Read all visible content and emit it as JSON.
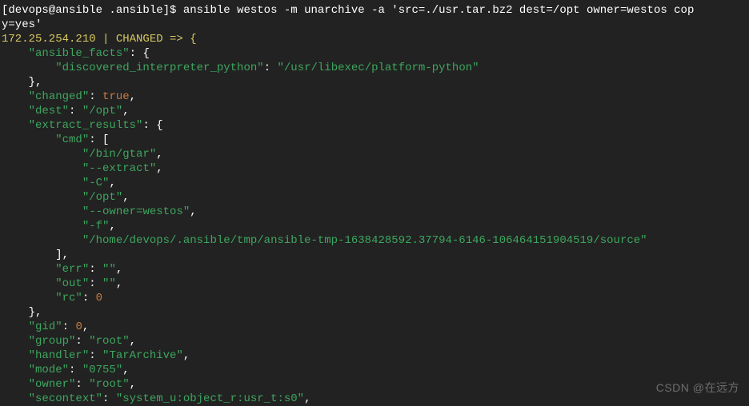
{
  "prompt": {
    "user_host_path": "[devops@ansible .ansible]",
    "symbol": "$",
    "command": "ansible westos -m unarchive -a 'src=./usr.tar.bz2 dest=/opt owner=westos copy=yes'"
  },
  "status_line": "172.25.254.210 | CHANGED => {",
  "output": {
    "lines": [
      {
        "indent": 1,
        "key": "\"ansible_facts\"",
        "sep": ": {",
        "val": ""
      },
      {
        "indent": 2,
        "key": "\"discovered_interpreter_python\"",
        "sep": ": ",
        "val": "\"/usr/libexec/platform-python\""
      },
      {
        "indent": 1,
        "key": "},",
        "sep": "",
        "val": ""
      },
      {
        "indent": 1,
        "key": "\"changed\"",
        "sep": ": ",
        "val": "true",
        "vnum": true,
        "comma": ","
      },
      {
        "indent": 1,
        "key": "\"dest\"",
        "sep": ": ",
        "val": "\"/opt\"",
        "comma": ","
      },
      {
        "indent": 1,
        "key": "\"extract_results\"",
        "sep": ": {",
        "val": ""
      },
      {
        "indent": 2,
        "key": "\"cmd\"",
        "sep": ": [",
        "val": ""
      },
      {
        "indent": 3,
        "key": "",
        "sep": "",
        "val": "\"/bin/gtar\"",
        "comma": ","
      },
      {
        "indent": 3,
        "key": "",
        "sep": "",
        "val": "\"--extract\"",
        "comma": ","
      },
      {
        "indent": 3,
        "key": "",
        "sep": "",
        "val": "\"-C\"",
        "comma": ","
      },
      {
        "indent": 3,
        "key": "",
        "sep": "",
        "val": "\"/opt\"",
        "comma": ","
      },
      {
        "indent": 3,
        "key": "",
        "sep": "",
        "val": "\"--owner=westos\"",
        "comma": ","
      },
      {
        "indent": 3,
        "key": "",
        "sep": "",
        "val": "\"-f\"",
        "comma": ","
      },
      {
        "indent": 3,
        "key": "",
        "sep": "",
        "val": "\"/home/devops/.ansible/tmp/ansible-tmp-1638428592.37794-6146-106464151904519/source\""
      },
      {
        "indent": 2,
        "key": "],",
        "sep": "",
        "val": ""
      },
      {
        "indent": 2,
        "key": "\"err\"",
        "sep": ": ",
        "val": "\"\"",
        "comma": ","
      },
      {
        "indent": 2,
        "key": "\"out\"",
        "sep": ": ",
        "val": "\"\"",
        "comma": ","
      },
      {
        "indent": 2,
        "key": "\"rc\"",
        "sep": ": ",
        "val": "0",
        "vnum": true
      },
      {
        "indent": 1,
        "key": "},",
        "sep": "",
        "val": ""
      },
      {
        "indent": 1,
        "key": "\"gid\"",
        "sep": ": ",
        "val": "0",
        "vnum": true,
        "comma": ","
      },
      {
        "indent": 1,
        "key": "\"group\"",
        "sep": ": ",
        "val": "\"root\"",
        "comma": ","
      },
      {
        "indent": 1,
        "key": "\"handler\"",
        "sep": ": ",
        "val": "\"TarArchive\"",
        "comma": ","
      },
      {
        "indent": 1,
        "key": "\"mode\"",
        "sep": ": ",
        "val": "\"0755\"",
        "comma": ","
      },
      {
        "indent": 1,
        "key": "\"owner\"",
        "sep": ": ",
        "val": "\"root\"",
        "comma": ","
      },
      {
        "indent": 1,
        "key": "\"secontext\"",
        "sep": ": ",
        "val": "\"system_u:object_r:usr_t:s0\"",
        "comma": ","
      }
    ]
  },
  "watermark": "CSDN @在远方"
}
